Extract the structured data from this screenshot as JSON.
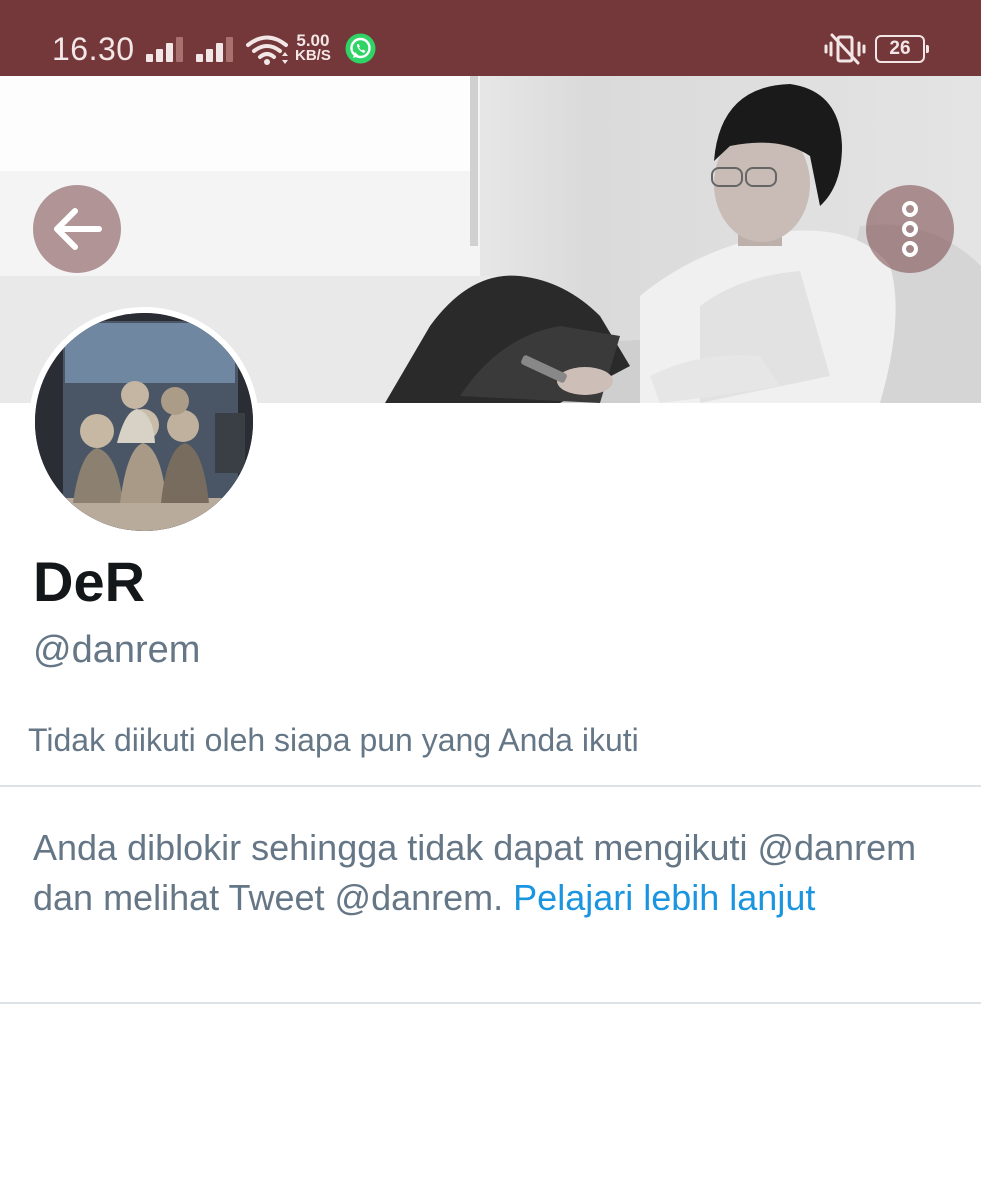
{
  "status_bar": {
    "time": "16.30",
    "net_speed_value": "5.00",
    "net_speed_unit": "KB/S",
    "battery_level": "26",
    "icons": [
      "signal-icon",
      "signal-icon",
      "wifi-icon",
      "whatsapp-icon",
      "vibrate-mute-icon",
      "battery-icon"
    ]
  },
  "header": {
    "back_icon": "arrow-left-icon",
    "menu_icon": "more-vertical-icon"
  },
  "profile": {
    "name": "DeR",
    "handle": "@danrem",
    "followed_by": "Tidak diikuti oleh siapa pun yang Anda ikuti"
  },
  "blocked": {
    "message": "Anda diblokir sehingga tidak dapat mengikuti @danrem dan melihat Tweet @danrem.",
    "link_text": "Pelajari lebih lanjut"
  },
  "colors": {
    "status_bar": "#75383a",
    "name_text": "#14171a",
    "secondary_text": "#657786",
    "link": "#1b95e0",
    "divider": "#dde2e6"
  }
}
